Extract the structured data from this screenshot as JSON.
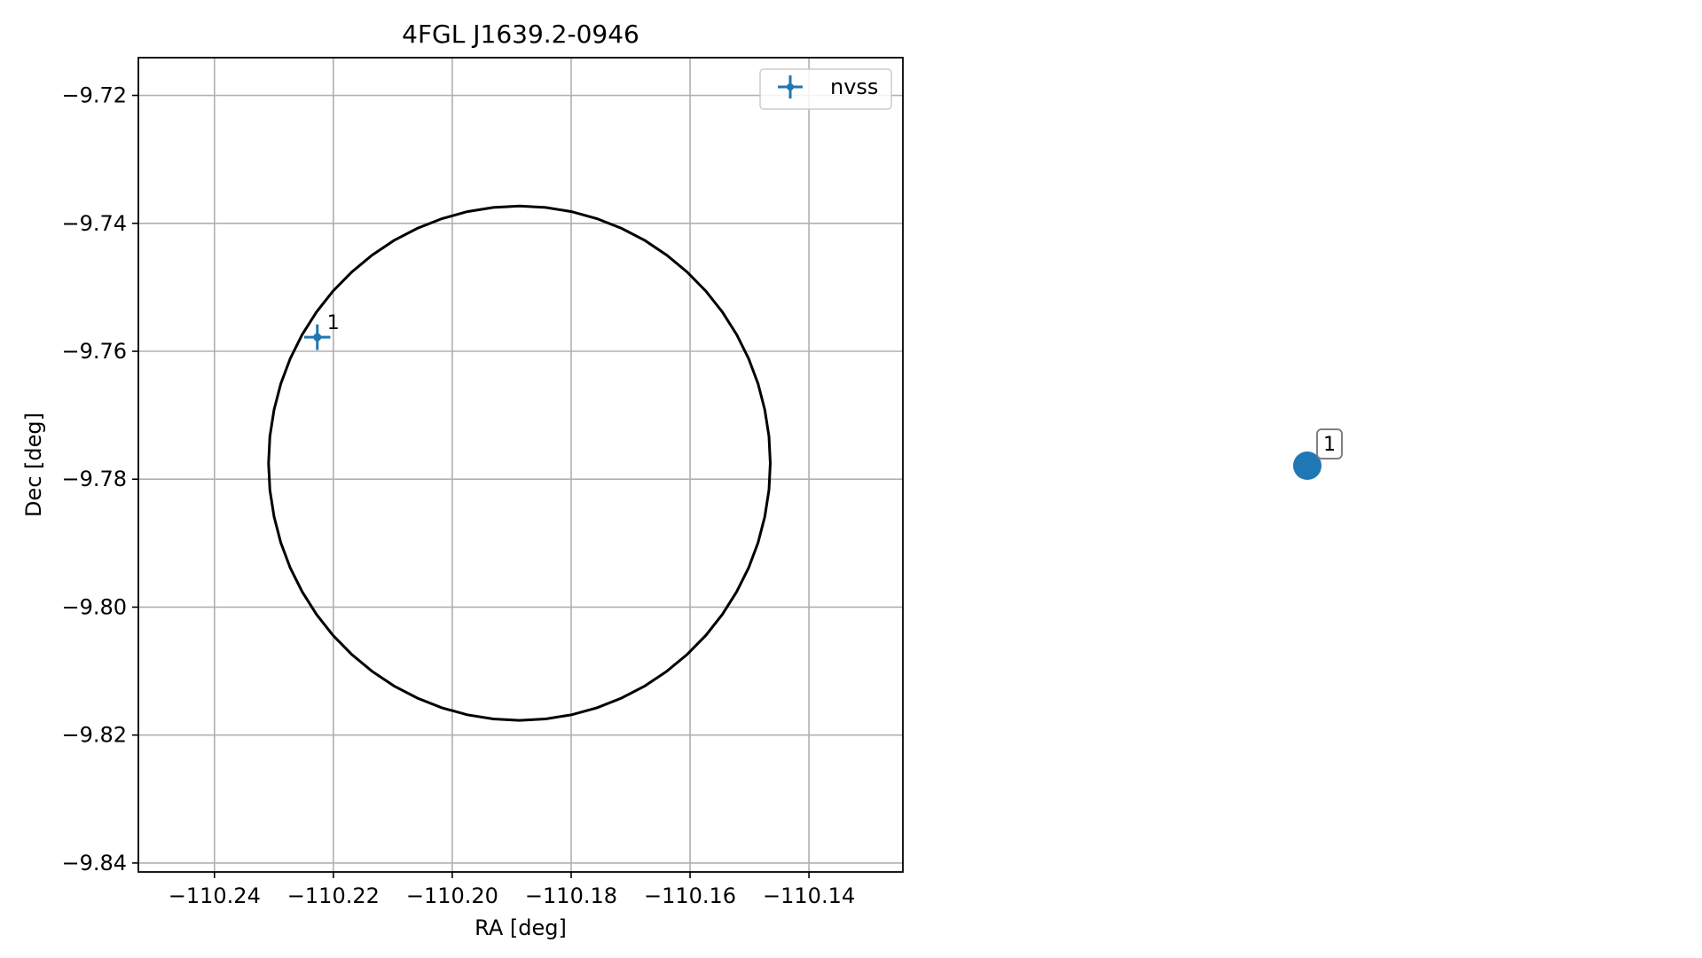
{
  "chart_data": [
    {
      "type": "scatter",
      "title": "4FGL J1639.2-0946",
      "xlabel": "RA [deg]",
      "ylabel": "Dec [deg]",
      "xlim": [
        -110.2528,
        -110.1242
      ],
      "ylim": [
        -9.8414,
        -9.7141
      ],
      "xticks": [
        -110.24,
        -110.22,
        -110.2,
        -110.18,
        -110.16,
        -110.14
      ],
      "xtick_labels": [
        "−110.24",
        "−110.22",
        "−110.20",
        "−110.18",
        "−110.16",
        "−110.14"
      ],
      "yticks": [
        -9.72,
        -9.74,
        -9.76,
        -9.78,
        -9.8,
        -9.82,
        -9.84
      ],
      "ytick_labels": [
        "−9.72",
        "−9.74",
        "−9.76",
        "−9.78",
        "−9.80",
        "−9.82",
        "−9.84"
      ],
      "grid": true,
      "legend": {
        "position": "top-right",
        "entries": [
          "nvss"
        ]
      },
      "series": [
        {
          "name": "nvss",
          "color": "#1f77b4",
          "marker": "errorbar-cross",
          "points": [
            {
              "x": -110.2227,
              "y": -9.7578,
              "xerr": 0.0022,
              "yerr": 0.002,
              "label": "1"
            }
          ]
        }
      ],
      "ellipse": {
        "center": [
          -110.1887,
          -9.7775
        ],
        "semi_axis_ra": 0.0422,
        "semi_axis_dec": 0.0402,
        "color": "#000000"
      }
    },
    {
      "type": "scatter",
      "axes_visible": false,
      "series": [
        {
          "color": "#1f77b4",
          "marker": "circle",
          "points": [
            {
              "label": "1"
            }
          ]
        }
      ]
    }
  ]
}
